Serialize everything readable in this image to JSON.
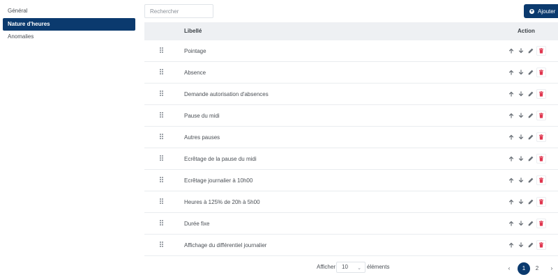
{
  "sidebar": {
    "items": [
      {
        "label": "Général"
      },
      {
        "label": "Nature d'heures"
      },
      {
        "label": "Anomalies"
      }
    ]
  },
  "toolbar": {
    "search_placeholder": "Rechercher",
    "add_label": "Ajouter"
  },
  "table": {
    "col_label": "Libellé",
    "col_action": "Action",
    "rows": [
      {
        "label": "Pointage"
      },
      {
        "label": "Absence"
      },
      {
        "label": "Demande autorisation d'absences"
      },
      {
        "label": "Pause du midi"
      },
      {
        "label": "Autres pauses"
      },
      {
        "label": "Ecrêtage de la pause du midi"
      },
      {
        "label": "Ecrêtage journalier à 10h00"
      },
      {
        "label": "Heures à 125% de 20h à 5h00"
      },
      {
        "label": "Durée fixe"
      },
      {
        "label": "Affichage du différentiel journalier"
      }
    ]
  },
  "footer": {
    "show_label": "Afficher",
    "page_size": "10",
    "elements_label": "éléments",
    "prev": "‹",
    "pages": [
      "1",
      "2"
    ],
    "next": "›"
  },
  "colors": {
    "primary": "#0b3a6e",
    "delete": "#e0364f",
    "icon": "#6b7178"
  }
}
